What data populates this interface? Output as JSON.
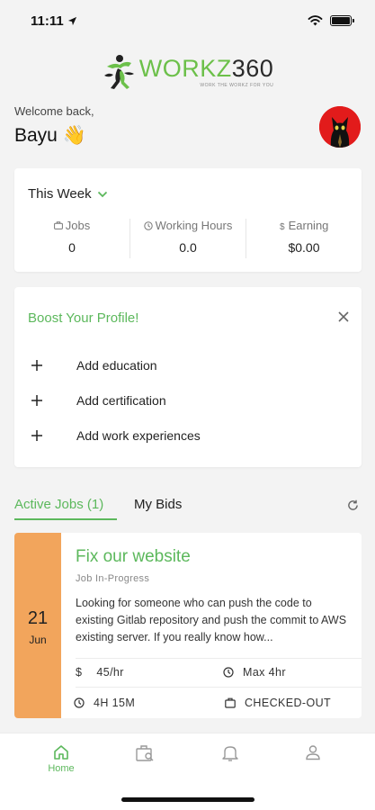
{
  "status_bar": {
    "time": "11:11"
  },
  "brand": {
    "name_part_1": "WORKZ",
    "name_part_2": "360",
    "tagline": "WORK THE WORKZ FOR YOU",
    "accent": "#6cc04a"
  },
  "welcome": {
    "greeting": "Welcome back,",
    "name": "Bayu",
    "emoji": "👋"
  },
  "week_card": {
    "period": "This Week",
    "stats": [
      {
        "label": "Jobs",
        "value": "0",
        "icon": "briefcase-icon"
      },
      {
        "label": "Working Hours",
        "value": "0.0",
        "icon": "clock-icon"
      },
      {
        "label": "Earning",
        "value": "$0.00",
        "icon": "dollar-icon"
      }
    ]
  },
  "boost": {
    "title": "Boost Your Profile!",
    "items": [
      "Add education",
      "Add certification",
      "Add work experiences"
    ]
  },
  "tabs": {
    "active": "Active Jobs (1)",
    "bids": "My Bids"
  },
  "job": {
    "day": "21",
    "month": "Jun",
    "title": "Fix our website",
    "status": "Job In-Progress",
    "description": "Looking for someone who can push the code to existing Gitlab repository and push the commit to  AWS existing server. If you really know how...",
    "rate_symbol": "$",
    "rate": "45/hr",
    "max": "Max 4hr",
    "time_logged": "4H 15M",
    "check_status": "CHECKED-OUT",
    "date_color": "#f2a55c"
  },
  "nav": {
    "home": "Home",
    "active_color": "#5cb85c"
  }
}
